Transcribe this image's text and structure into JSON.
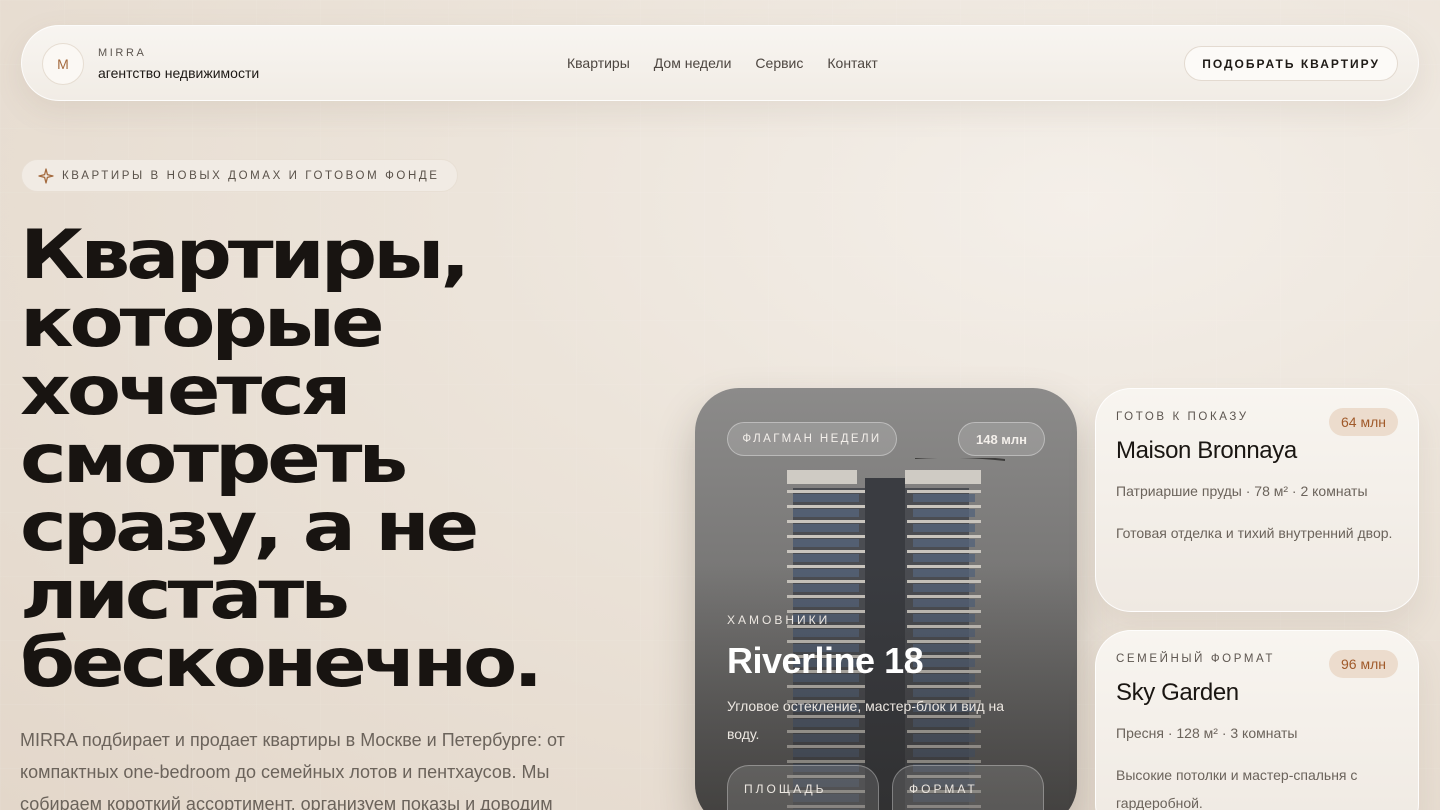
{
  "header": {
    "logo_letter": "M",
    "brand_name": "MIRRA",
    "brand_sub": "агентство недвижимости",
    "nav": [
      "Квартиры",
      "Дом недели",
      "Сервис",
      "Контакт"
    ],
    "cta_label": "ПОДОБРАТЬ КВАРТИРУ"
  },
  "hero": {
    "tag_icon": "sparkle-icon",
    "tag": "КВАРТИРЫ В НОВЫХ ДОМАХ И ГОТОВОМ ФОНДЕ",
    "title_lines": [
      "Квартиры,",
      "которые",
      "хочется",
      "смотреть",
      "сразу, а не",
      "листать",
      "бесконечно."
    ],
    "text": "MIRRA подбирает и продает квартиры в Москве и Петербурге: от компактных one-bedroom до семейных лотов и пентхаусов. Мы собираем короткий ассортимент, организуем показы и доводим"
  },
  "flagship": {
    "badge": "ФЛАГМАН НЕДЕЛИ",
    "price": "148 млн",
    "district": "ХАМОВНИКИ",
    "name": "Riverline 18",
    "description": "Угловое остекление, мастер-блок и вид на воду.",
    "stats": [
      "ПЛОЩАДЬ",
      "ФОРМАТ"
    ]
  },
  "cards": [
    {
      "overline": "ГОТОВ К ПОКАЗУ",
      "price": "64 млн",
      "name": "Maison Bronnaya",
      "meta": "Патриаршие пруды · 78 м² · 2 комнаты",
      "description": "Готовая отделка и тихий внутренний двор."
    },
    {
      "overline": "СЕМЕЙНЫЙ ФОРМАТ",
      "price": "96 млн",
      "name": "Sky Garden",
      "meta": "Пресня · 128 м² · 3 комнаты",
      "description": "Высокие потолки и мастер-спальня с гардеробной."
    }
  ],
  "colors": {
    "accent": "#a46a3e",
    "price_badge_bg": "#ecdccd",
    "title": "#181411"
  }
}
